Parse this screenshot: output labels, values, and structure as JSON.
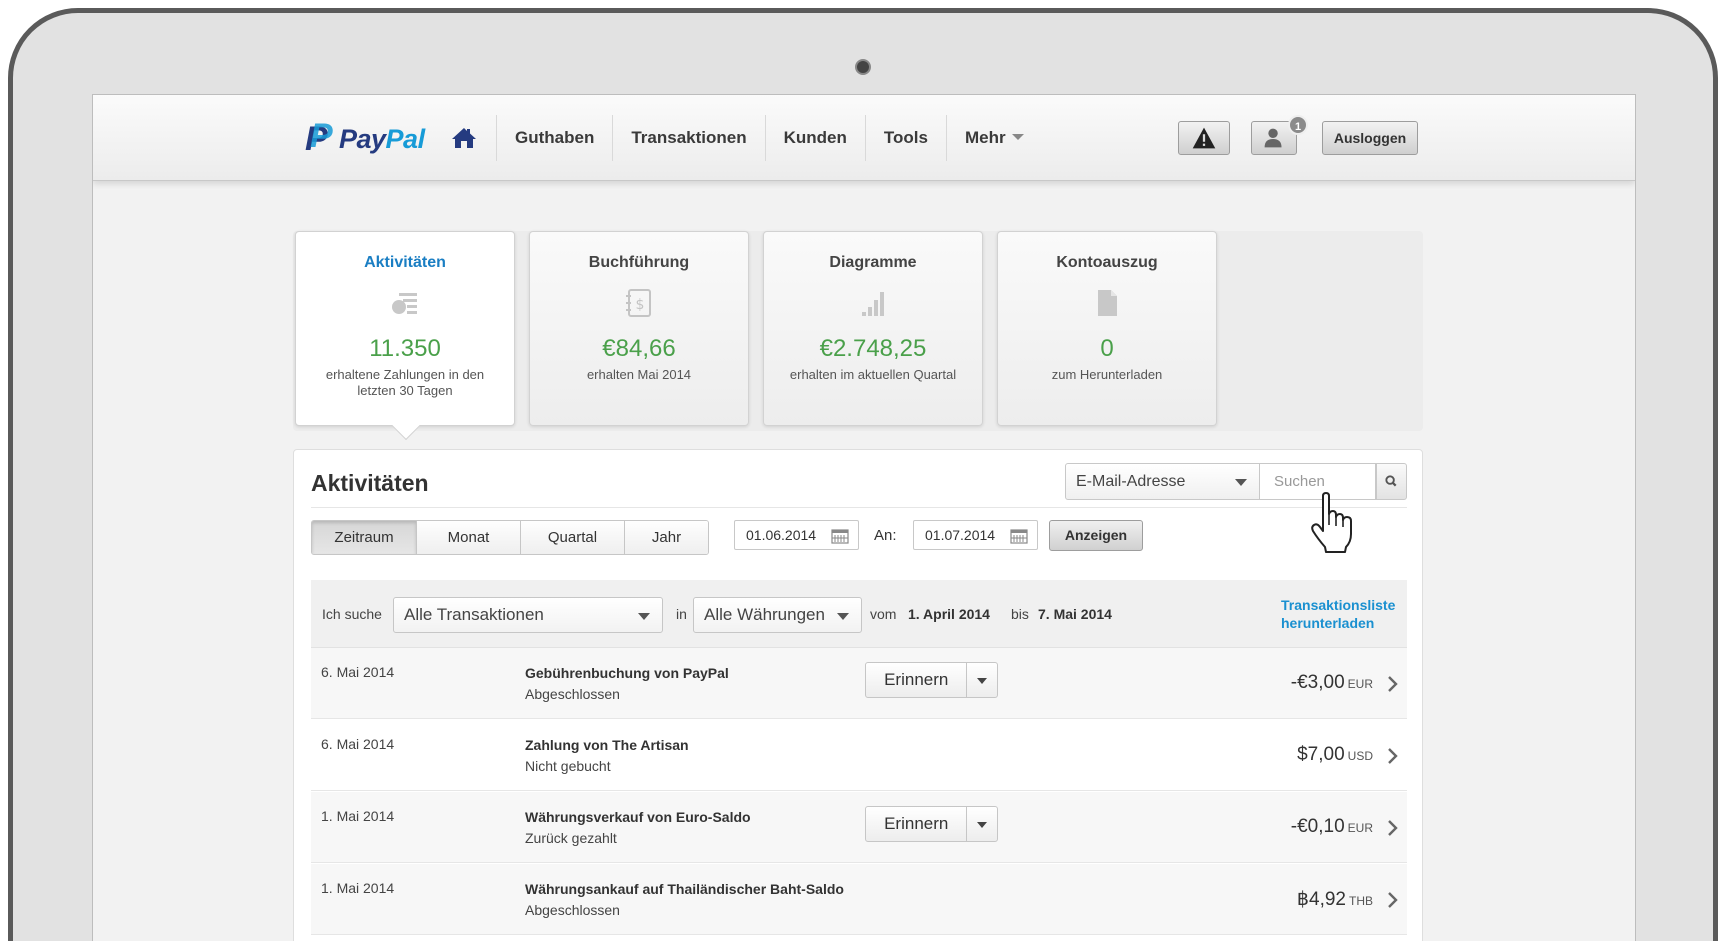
{
  "nav": {
    "brand_pay": "Pay",
    "brand_pal": "Pal",
    "links": [
      "Guthaben",
      "Transaktionen",
      "Kunden",
      "Tools",
      "Mehr"
    ],
    "notification_count": "1",
    "logout_label": "Ausloggen"
  },
  "cards": [
    {
      "title": "Aktivitäten",
      "icon": "activity-list-icon",
      "value": "11.350",
      "sub": "erhaltene Zahlungen in den letzten 30 Tagen"
    },
    {
      "title": "Buchführung",
      "icon": "ledger-icon",
      "value": "€84,66",
      "sub": "erhalten Mai 2014"
    },
    {
      "title": "Diagramme",
      "icon": "bar-chart-icon",
      "value": "€2.748,25",
      "sub": "erhalten im aktuellen Quartal"
    },
    {
      "title": "Kontoauszug",
      "icon": "document-icon",
      "value": "0",
      "sub": "zum Herunterladen"
    }
  ],
  "activity": {
    "title": "Aktivitäten",
    "search_type": "E-Mail-Adresse",
    "search_placeholder": "Suchen",
    "periods": [
      "Zeitraum",
      "Monat",
      "Quartal",
      "Jahr"
    ],
    "date_from": "01.06.2014",
    "date_to_label": "An:",
    "date_to": "01.07.2014",
    "show_button": "Anzeigen"
  },
  "filter": {
    "prefix": "Ich suche",
    "transactions": "Alle Transaktionen",
    "in_label": "in",
    "currencies": "Alle Währungen",
    "from_label": "vom",
    "from_date": "1. April 2014",
    "to_label": "bis",
    "to_date": "7. Mai 2014",
    "download_line1": "Transaktionsliste",
    "download_line2": "herunterladen"
  },
  "transactions": [
    {
      "date": "6. Mai 2014",
      "name": "Gebührenbuchung von PayPal",
      "status": "Abgeschlossen",
      "remind": "Erinnern",
      "amount": "-€3,00",
      "currency": "EUR"
    },
    {
      "date": "6. Mai 2014",
      "name": "Zahlung von The Artisan",
      "status": "Nicht gebucht",
      "remind": "",
      "amount": "$7,00",
      "currency": "USD"
    },
    {
      "date": "1. Mai 2014",
      "name": "Währungsverkauf von Euro-Saldo",
      "status": "Zurück gezahlt",
      "remind": "Erinnern",
      "amount": "-€0,10",
      "currency": "EUR"
    },
    {
      "date": "1. Mai 2014",
      "name": "Währungsankauf auf Thailändischer Baht-Saldo",
      "status": "Abgeschlossen",
      "remind": "",
      "amount": "฿4,92",
      "currency": "THB"
    }
  ],
  "colors": {
    "brand_dark": "#253b80",
    "brand_light": "#179bd7",
    "value_green": "#4aa04a",
    "link_blue": "#1a90d0"
  }
}
